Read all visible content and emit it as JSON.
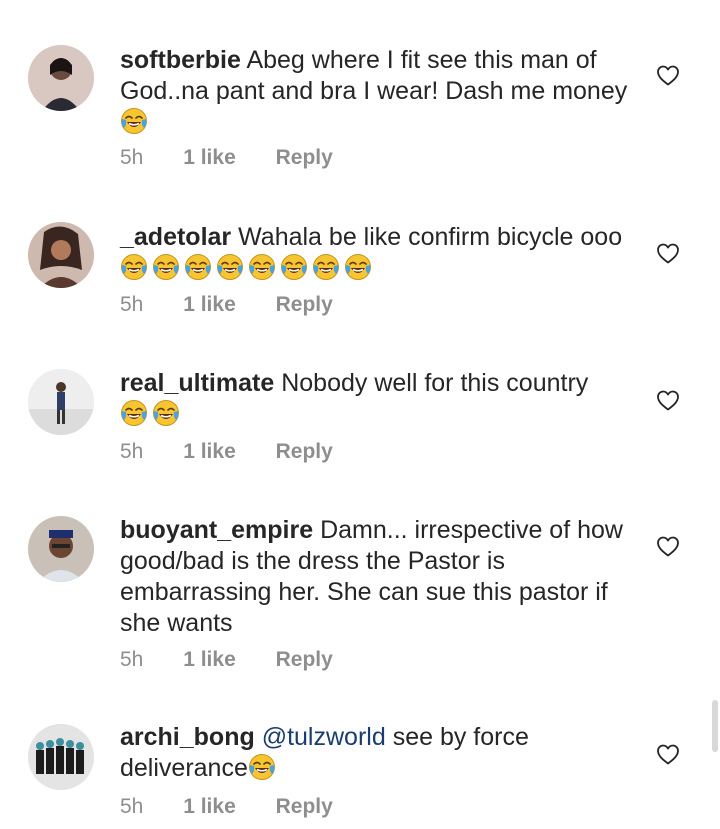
{
  "comments": [
    {
      "username": "softberbie",
      "text": "Abeg where I fit see this man of God..na pant and bra I wear! Dash me money",
      "emoji_count": 1,
      "time": "5h",
      "likes": "1 like",
      "reply": "Reply"
    },
    {
      "username": "_adetolar",
      "text": "Wahala be like confirm bicycle ooo",
      "emoji_count": 8,
      "time": "5h",
      "likes": "1 like",
      "reply": "Reply"
    },
    {
      "username": "real_ultimate",
      "text": "Nobody well for this country",
      "emoji_count": 2,
      "time": "5h",
      "likes": "1 like",
      "reply": "Reply"
    },
    {
      "username": "buoyant_empire",
      "text": "Damn... irrespective of how good/bad is the dress the Pastor is embarrassing her. She can sue this pastor if she wants",
      "emoji_count": 0,
      "time": "5h",
      "likes": "1 like",
      "reply": "Reply"
    },
    {
      "username": "archi_bong",
      "mention": "@tulzworld",
      "text": "see by force deliverance",
      "emoji_count": 1,
      "time": "5h",
      "likes": "1 like",
      "reply": "Reply"
    }
  ],
  "icons": {
    "like": "heart-outline-icon",
    "emoji": "face-with-tears-of-joy-emoji"
  },
  "colors": {
    "text": "#262626",
    "meta": "#8e8e8e",
    "mention": "#1a3d6e"
  }
}
